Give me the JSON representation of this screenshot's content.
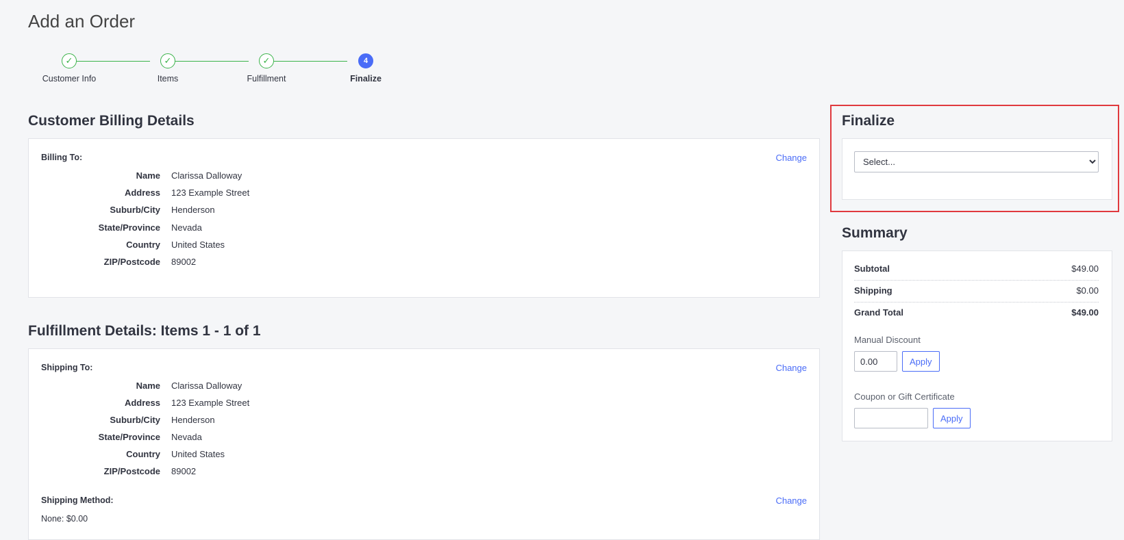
{
  "page": {
    "title": "Add an Order"
  },
  "stepper": {
    "steps": [
      {
        "label": "Customer Info",
        "state": "done"
      },
      {
        "label": "Items",
        "state": "done"
      },
      {
        "label": "Fulfillment",
        "state": "done"
      },
      {
        "label": "Finalize",
        "state": "active",
        "number": "4"
      }
    ],
    "done_glyph": "✓",
    "done_color": "#3bb34a",
    "active_color": "#4a6cf7"
  },
  "billing": {
    "section_title": "Customer Billing Details",
    "heading": "Billing To:",
    "change_label": "Change",
    "rows": [
      {
        "label": "Name",
        "value": "Clarissa Dalloway"
      },
      {
        "label": "Address",
        "value": "123 Example Street"
      },
      {
        "label": "Suburb/City",
        "value": "Henderson"
      },
      {
        "label": "State/Province",
        "value": "Nevada"
      },
      {
        "label": "Country",
        "value": "United States"
      },
      {
        "label": "ZIP/Postcode",
        "value": "89002"
      }
    ]
  },
  "fulfillment": {
    "section_title": "Fulfillment Details: Items 1 - 1 of 1",
    "heading": "Shipping To:",
    "change_label": "Change",
    "rows": [
      {
        "label": "Name",
        "value": "Clarissa Dalloway"
      },
      {
        "label": "Address",
        "value": "123 Example Street"
      },
      {
        "label": "Suburb/City",
        "value": "Henderson"
      },
      {
        "label": "State/Province",
        "value": "Nevada"
      },
      {
        "label": "Country",
        "value": "United States"
      },
      {
        "label": "ZIP/Postcode",
        "value": "89002"
      }
    ],
    "method_heading": "Shipping Method:",
    "method_change_label": "Change",
    "method_value": "None: $0.00"
  },
  "finalize": {
    "section_title": "Finalize",
    "select_value": "Select...",
    "highlight_color": "#e0393e"
  },
  "summary": {
    "section_title": "Summary",
    "rows": [
      {
        "label": "Subtotal",
        "value": "$49.00"
      },
      {
        "label": "Shipping",
        "value": "$0.00"
      },
      {
        "label": "Grand Total",
        "value": "$49.00"
      }
    ],
    "manual_discount": {
      "label": "Manual Discount",
      "value": "0.00",
      "button": "Apply"
    },
    "coupon": {
      "label": "Coupon or Gift Certificate",
      "value": "",
      "button": "Apply"
    }
  }
}
